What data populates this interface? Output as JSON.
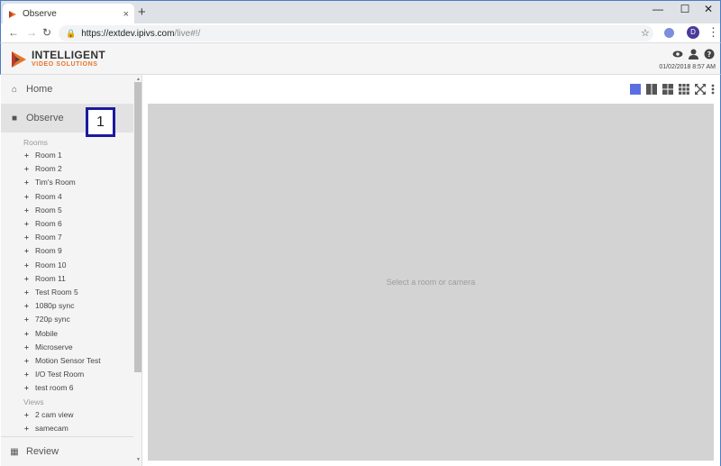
{
  "browser": {
    "tab_title": "Observe",
    "tab_close": "×",
    "new_tab": "+",
    "min": "—",
    "max": "☐",
    "close": "✕",
    "back": "←",
    "forward": "→",
    "reload": "↻",
    "url_host": "https://extdev.ipivs.com",
    "url_path": "/live#!/",
    "star": "☆",
    "profile_initial": "D",
    "menu": "⋮"
  },
  "header": {
    "logo_line1": "INTELLIGENT",
    "logo_line2": "VIDEO SOLUTIONS",
    "datetime": "01/02/2018 8:57 AM",
    "icons": [
      "eye-icon",
      "user-icon",
      "help-icon"
    ],
    "accent": "#e8732a"
  },
  "sidebar": {
    "home_label": "Home",
    "observe_label": "Observe",
    "rooms_header": "Rooms",
    "rooms": [
      "Room 1",
      "Room 2",
      "Tim's Room",
      "Room 4",
      "Room 5",
      "Room 6",
      "Room 7",
      "Room 9",
      "Room 10",
      "Room 11",
      "Test Room 5",
      "1080p sync",
      "720p sync",
      "Mobile",
      "Microserve",
      "Motion Sensor Test",
      "I/O Test Room",
      "test room 6"
    ],
    "views_header": "Views",
    "views": [
      "2 cam view",
      "samecam"
    ],
    "review_label": "Review"
  },
  "callout": {
    "label": "1",
    "color": "#1a1a9e"
  },
  "main": {
    "placeholder": "Select a room or camera",
    "layout_icons": [
      "layout-1x1-icon",
      "layout-2x1-icon",
      "layout-2x2-icon",
      "layout-3x3-icon",
      "fullscreen-icon",
      "more-icon"
    ],
    "active_layout_color": "#5b6ee1"
  }
}
